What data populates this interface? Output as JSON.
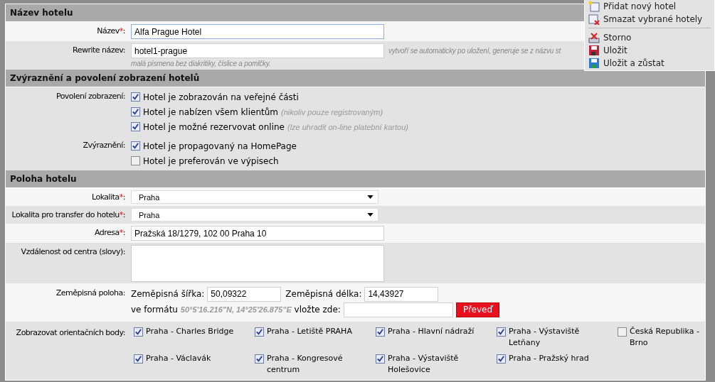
{
  "sections": [
    {
      "title": "Název hotelu",
      "rows": [
        {
          "kind": "text",
          "label": "Název",
          "required_mark": "*",
          "colon": ":",
          "value": "Alfa Prague Hotel",
          "focused": true
        },
        {
          "kind": "text",
          "label": "Rewrite název",
          "colon": ":",
          "value": "hotel1-prague",
          "focused": false,
          "hint": "vytvoří se automaticky po uložení, generuje se z názvu st",
          "hint_2": "malá písmena bez diakritiky, číslice a pomlčky."
        }
      ]
    },
    {
      "title": "Zvýraznění a povolení zobrazení hotelů",
      "rows": [
        {
          "kind": "checks",
          "label": "Povolení zobrazení",
          "colon": ":",
          "options": [
            {
              "label": "Hotel je zobrazován na veřejné části",
              "checked": true
            },
            {
              "label": "Hotel je nabízen všem klientům",
              "note": "(nikoliv pouze registrovaným)",
              "checked": true
            },
            {
              "label": "Hotel je možné rezervovat online",
              "note": "(lze uhradit on-line platební kartou)",
              "checked": true
            }
          ]
        },
        {
          "kind": "checks",
          "label": "Zvýraznění",
          "colon": ":",
          "options": [
            {
              "label": "Hotel je propagovaný na HomePage",
              "checked": true
            },
            {
              "label": "Hotel je preferován ve výpisech",
              "checked": false
            }
          ]
        }
      ]
    },
    {
      "title": "Poloha hotelu",
      "rows": [
        {
          "kind": "select",
          "label": "Lokalita",
          "required_mark": "*",
          "colon": ":",
          "value": "Praha"
        },
        {
          "kind": "select",
          "label": "Lokalita pro transfer do hotelu",
          "required_mark": "*",
          "colon": ":",
          "value": "Praha"
        },
        {
          "kind": "text",
          "label": "Adresa",
          "required_mark": "*",
          "colon": ":",
          "value": "Pražská 18/1279, 102 00 Praha 10",
          "focused": false
        },
        {
          "kind": "textarea",
          "label": "Vzdálenost od centra (slovy)",
          "colon": ":"
        },
        {
          "kind": "geo",
          "label": "Zeměpisná poloha",
          "colon": ":",
          "lat_label": "Zeměpisná šířka:",
          "lat": "50,09322",
          "lon_label": "Zeměpisná délka:",
          "lon": "14,43927",
          "format_prefix": "ve formátu",
          "format_example": "50°5'16.216\"N, 14°25'26.875\"E",
          "format_suffix": "vložte zde:",
          "convert_button": "Převeď"
        },
        {
          "kind": "points",
          "label": "Zobrazovat orientačních body",
          "colon": ":",
          "options": [
            {
              "label": "Praha - Charles Bridge",
              "checked": true
            },
            {
              "label": "Praha - Letiště PRAHA",
              "checked": true
            },
            {
              "label": "Praha - Hlavní nádraží",
              "checked": true
            },
            {
              "label": "Praha - Výstaviště Letňany",
              "checked": true
            },
            {
              "label": "Česká Republika - Brno",
              "checked": false
            },
            {
              "label": "Praha - Václavák",
              "checked": true
            },
            {
              "label": "Praha - Kongresové centrum",
              "checked": true
            },
            {
              "label": "Praha - Výstaviště Holešovice",
              "checked": true
            },
            {
              "label": "Praha - Pražský hrad",
              "checked": true
            }
          ]
        }
      ]
    }
  ],
  "menu": [
    {
      "kind": "new",
      "label": "Přidat nový hotel"
    },
    {
      "kind": "delete",
      "label": "Smazat vybrané hotely"
    },
    {
      "kind": "separator"
    },
    {
      "kind": "cancel",
      "label": "Storno"
    },
    {
      "kind": "save",
      "label": "Uložit"
    },
    {
      "kind": "save_stay",
      "label": "Uložit a zůstat"
    }
  ]
}
